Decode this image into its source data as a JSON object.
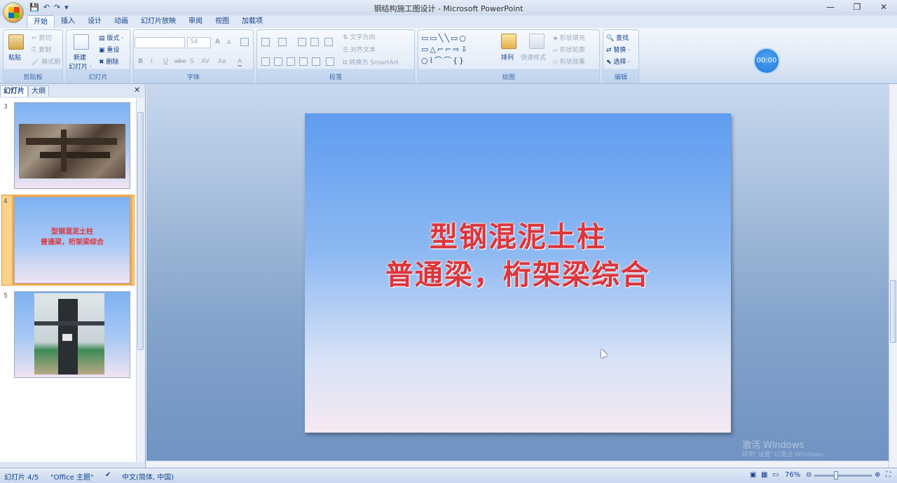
{
  "window": {
    "title": "钢结构施工图设计 - Microsoft PowerPoint",
    "min": "—",
    "max": "❐",
    "close": "✕"
  },
  "qat": {
    "save": "💾",
    "undo": "↶",
    "redo": "↷",
    "more": "▾"
  },
  "tabs": [
    "开始",
    "插入",
    "设计",
    "动画",
    "幻灯片放映",
    "审阅",
    "视图",
    "加载项"
  ],
  "ribbon": {
    "clipboard": {
      "label": "剪贴板",
      "paste": "粘贴",
      "cut": "剪切",
      "copy": "复制",
      "format_painter": "格式刷"
    },
    "slides": {
      "label": "幻灯片",
      "new_slide": "新建",
      "new_slide2": "幻灯片 ·",
      "layout": "版式 ·",
      "reset": "重设",
      "delete": "删除"
    },
    "font": {
      "label": "字体",
      "size": "54",
      "grow": "A",
      "shrink": "A",
      "bold": "B",
      "italic": "I",
      "underline": "U",
      "strike": "abe",
      "shadow": "S",
      "spacing": "AV",
      "case": "Aa",
      "color": "A"
    },
    "paragraph": {
      "label": "段落",
      "text_dir": "文字方向",
      "align_text": "对齐文本",
      "smartart": "转换为 SmartArt"
    },
    "drawing": {
      "label": "绘图",
      "arrange": "排列",
      "quick_styles": "快速样式",
      "fill": "形状填充",
      "outline": "形状轮廓",
      "effects": "形状效果"
    },
    "editing": {
      "label": "编辑",
      "find": "查找",
      "replace": "替换 ·",
      "select": "选择 ·"
    }
  },
  "timer": "00:00",
  "left_pane": {
    "tab_slides": "幻灯片",
    "tab_outline": "大纲",
    "close": "✕",
    "thumbs": [
      {
        "num": "3"
      },
      {
        "num": "4",
        "line1": "型钢混泥土柱",
        "line2": "普通梁，桁架梁综合"
      },
      {
        "num": "5"
      }
    ]
  },
  "slide": {
    "line1": "型钢混泥土柱",
    "line2": "普通梁，桁架梁综合"
  },
  "watermark": {
    "line1": "激活 Windows",
    "line2": "转到“设置”以激活 Windows。"
  },
  "status": {
    "slide_pos": "幻灯片 4/5",
    "theme": "\"Office 主题\"",
    "lang": "中文(简体, 中国)",
    "zoom": "76%"
  }
}
